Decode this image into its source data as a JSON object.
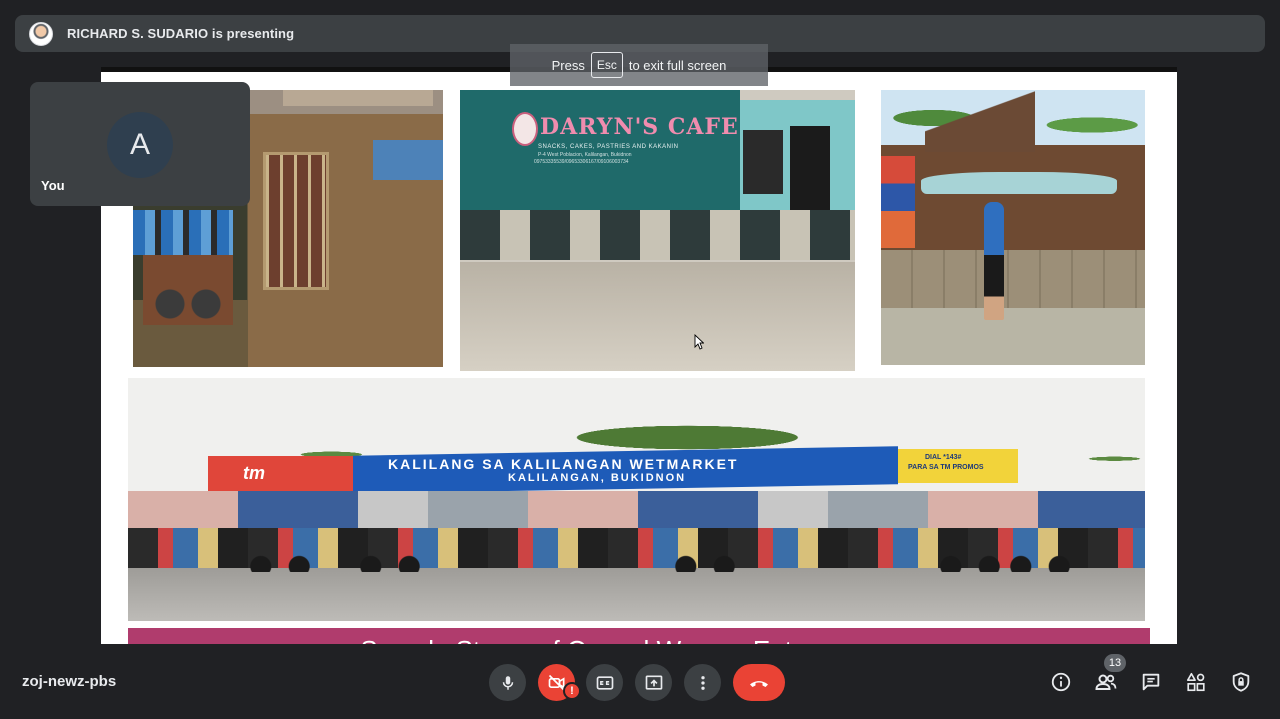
{
  "presenter": {
    "text": "RICHARD S. SUDARIO is presenting",
    "avatar_icon": "presenter-avatar"
  },
  "esc_hint": {
    "prefix": "Press",
    "key": "Esc",
    "suffix": "to exit full screen"
  },
  "self_tile": {
    "avatar_initial": "A",
    "label": "You"
  },
  "slide": {
    "photos": [
      {
        "name": "hut-store-photo"
      },
      {
        "name": "cafe-photo",
        "sign_title": "DARYN'S CAFE",
        "sign_tagline": "SNACKS, CAKES, PASTRIES AND KAKANIN",
        "sign_address": "P-4 West Poblacion, Kalilangan, Bukidnon",
        "sign_phone": "09753335539/09653306167/09106003734"
      },
      {
        "name": "roadside-stall-photo"
      },
      {
        "name": "wetmarket-photo",
        "banner_logo": "tm",
        "banner_line1": "KALILANG SA KALILANGAN WETMARKET",
        "banner_line2": "KALILANGAN, BUKIDNON",
        "promo_line1": "DIAL *143#",
        "promo_line2": "PARA SA TM PROMOS"
      }
    ],
    "caption": "Sample Stores of Owned Women Entrepreneurs"
  },
  "bottom_bar": {
    "meeting_code": "zoj-newz-pbs",
    "controls": [
      "mic-icon",
      "camera-off-icon",
      "captions-icon",
      "present-icon",
      "more-icon",
      "end-call-icon"
    ],
    "camera_alert": "!",
    "participants_count": "13",
    "right_icons": [
      "info-icon",
      "people-icon",
      "chat-icon",
      "activities-icon",
      "host-controls-icon"
    ]
  },
  "colors": {
    "background": "#202124",
    "surface": "#3c4043",
    "danger": "#ea4335",
    "caption_bar": "#b03c6d"
  }
}
